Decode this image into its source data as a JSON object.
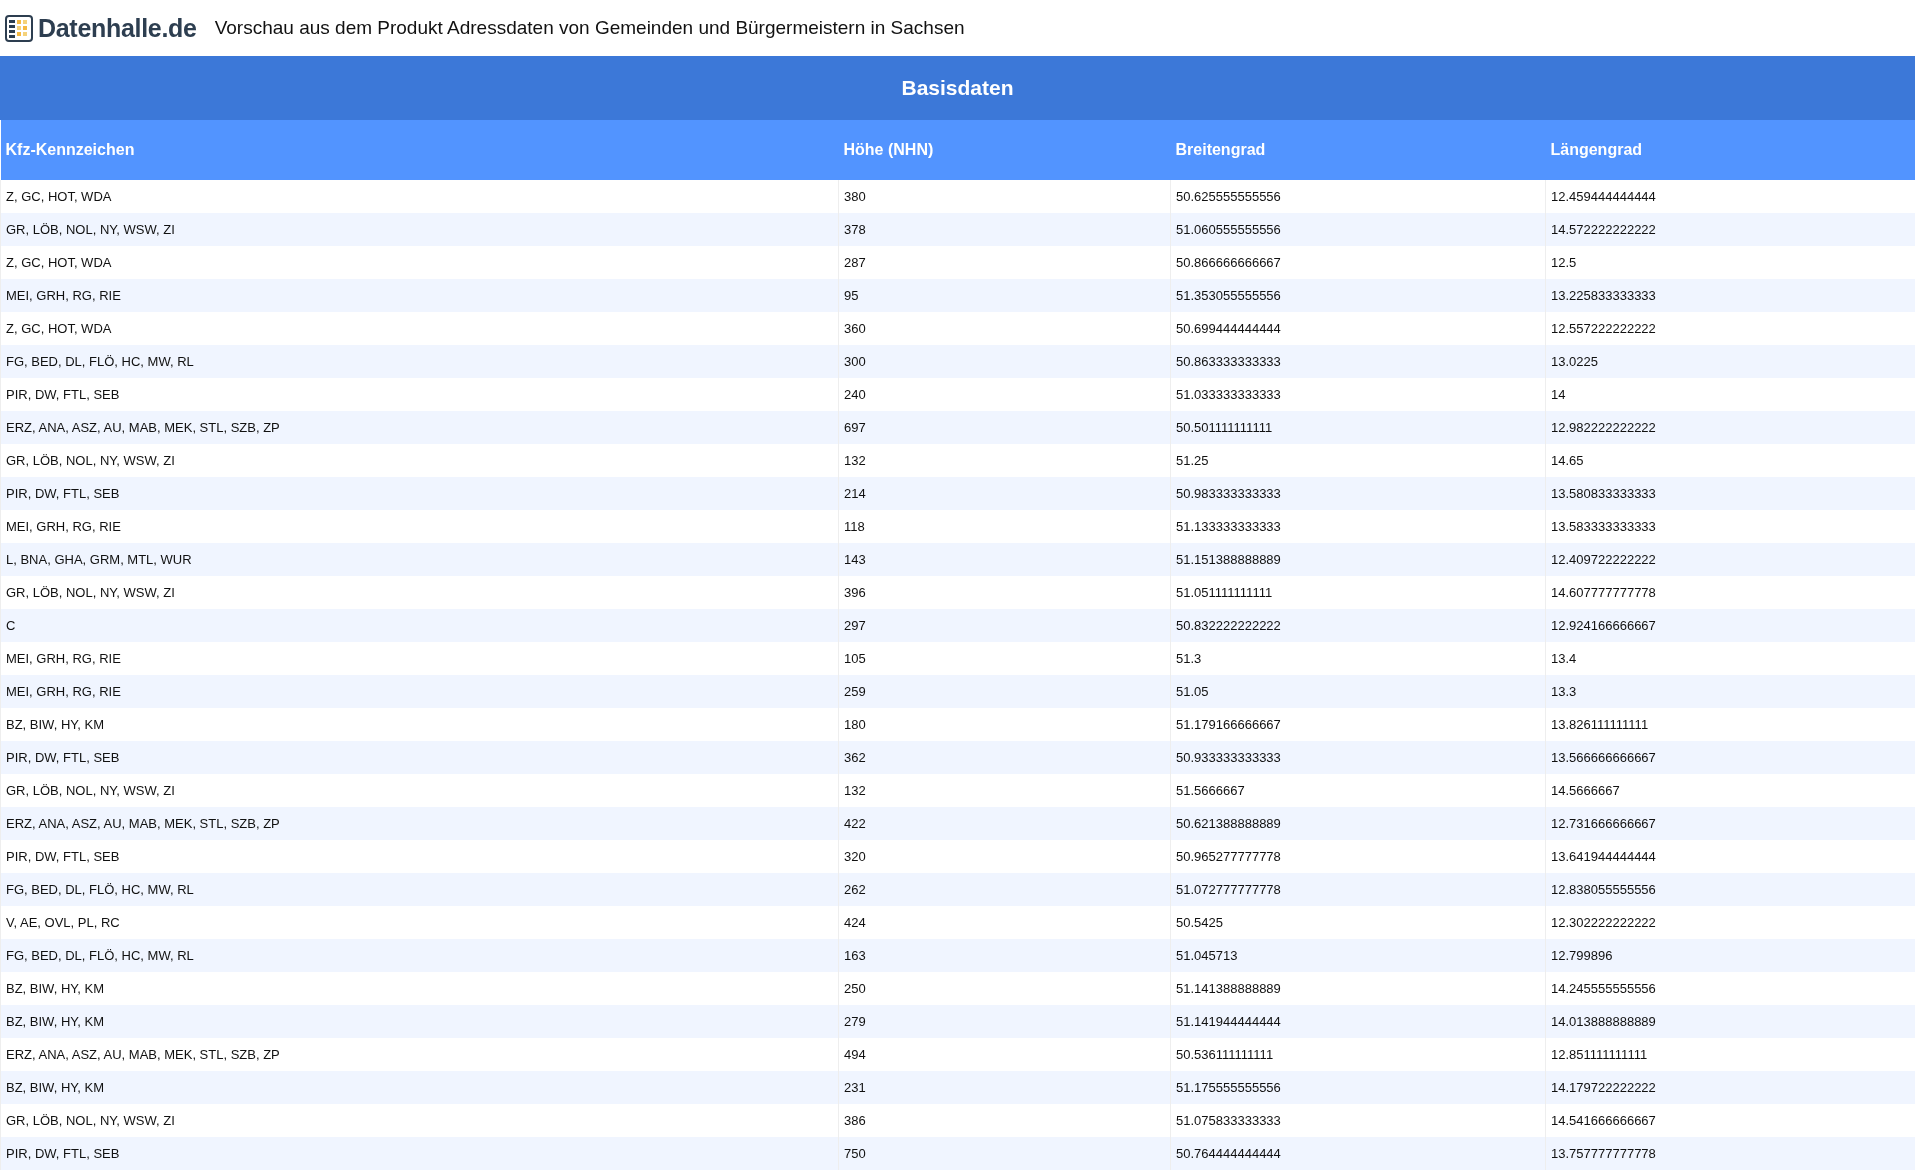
{
  "header": {
    "logo_text": "Datenhalle.de",
    "title": "Vorschau aus dem Produkt Adressdaten von Gemeinden und Bürgermeistern in Sachsen"
  },
  "table": {
    "caption": "Basisdaten",
    "columns": [
      "Kfz-Kennzeichen",
      "Höhe (NHN)",
      "Breitengrad",
      "Längengrad"
    ],
    "rows": [
      [
        "Z, GC, HOT, WDA",
        "380",
        "50.625555555556",
        "12.459444444444"
      ],
      [
        "GR, LÖB, NOL, NY, WSW, ZI",
        "378",
        "51.060555555556",
        "14.572222222222"
      ],
      [
        "Z, GC, HOT, WDA",
        "287",
        "50.866666666667",
        "12.5"
      ],
      [
        "MEI, GRH, RG, RIE",
        "95",
        "51.353055555556",
        "13.225833333333"
      ],
      [
        "Z, GC, HOT, WDA",
        "360",
        "50.699444444444",
        "12.557222222222"
      ],
      [
        "FG, BED, DL, FLÖ, HC, MW, RL",
        "300",
        "50.863333333333",
        "13.0225"
      ],
      [
        "PIR, DW, FTL, SEB",
        "240",
        "51.033333333333",
        "14"
      ],
      [
        "ERZ, ANA, ASZ, AU, MAB, MEK, STL, SZB, ZP",
        "697",
        "50.501111111111",
        "12.982222222222"
      ],
      [
        "GR, LÖB, NOL, NY, WSW, ZI",
        "132",
        "51.25",
        "14.65"
      ],
      [
        "PIR, DW, FTL, SEB",
        "214",
        "50.983333333333",
        "13.580833333333"
      ],
      [
        "MEI, GRH, RG, RIE",
        "118",
        "51.133333333333",
        "13.583333333333"
      ],
      [
        "L, BNA, GHA, GRM, MTL, WUR",
        "143",
        "51.151388888889",
        "12.409722222222"
      ],
      [
        "GR, LÖB, NOL, NY, WSW, ZI",
        "396",
        "51.051111111111",
        "14.607777777778"
      ],
      [
        "C",
        "297",
        "50.832222222222",
        "12.924166666667"
      ],
      [
        "MEI, GRH, RG, RIE",
        "105",
        "51.3",
        "13.4"
      ],
      [
        "MEI, GRH, RG, RIE",
        "259",
        "51.05",
        "13.3"
      ],
      [
        "BZ, BIW, HY, KM",
        "180",
        "51.179166666667",
        "13.826111111111"
      ],
      [
        "PIR, DW, FTL, SEB",
        "362",
        "50.933333333333",
        "13.566666666667"
      ],
      [
        "GR, LÖB, NOL, NY, WSW, ZI",
        "132",
        "51.5666667",
        "14.5666667"
      ],
      [
        "ERZ, ANA, ASZ, AU, MAB, MEK, STL, SZB, ZP",
        "422",
        "50.621388888889",
        "12.731666666667"
      ],
      [
        "PIR, DW, FTL, SEB",
        "320",
        "50.965277777778",
        "13.641944444444"
      ],
      [
        "FG, BED, DL, FLÖ, HC, MW, RL",
        "262",
        "51.072777777778",
        "12.838055555556"
      ],
      [
        "V, AE, OVL, PL, RC",
        "424",
        "50.5425",
        "12.302222222222"
      ],
      [
        "FG, BED, DL, FLÖ, HC, MW, RL",
        "163",
        "51.045713",
        "12.799896"
      ],
      [
        "BZ, BIW, HY, KM",
        "250",
        "51.141388888889",
        "14.245555555556"
      ],
      [
        "BZ, BIW, HY, KM",
        "279",
        "51.141944444444",
        "14.013888888889"
      ],
      [
        "ERZ, ANA, ASZ, AU, MAB, MEK, STL, SZB, ZP",
        "494",
        "50.536111111111",
        "12.851111111111"
      ],
      [
        "BZ, BIW, HY, KM",
        "231",
        "51.175555555556",
        "14.179722222222"
      ],
      [
        "GR, LÖB, NOL, NY, WSW, ZI",
        "386",
        "51.075833333333",
        "14.541666666667"
      ],
      [
        "PIR, DW, FTL, SEB",
        "750",
        "50.764444444444",
        "13.757777777778"
      ]
    ]
  }
}
